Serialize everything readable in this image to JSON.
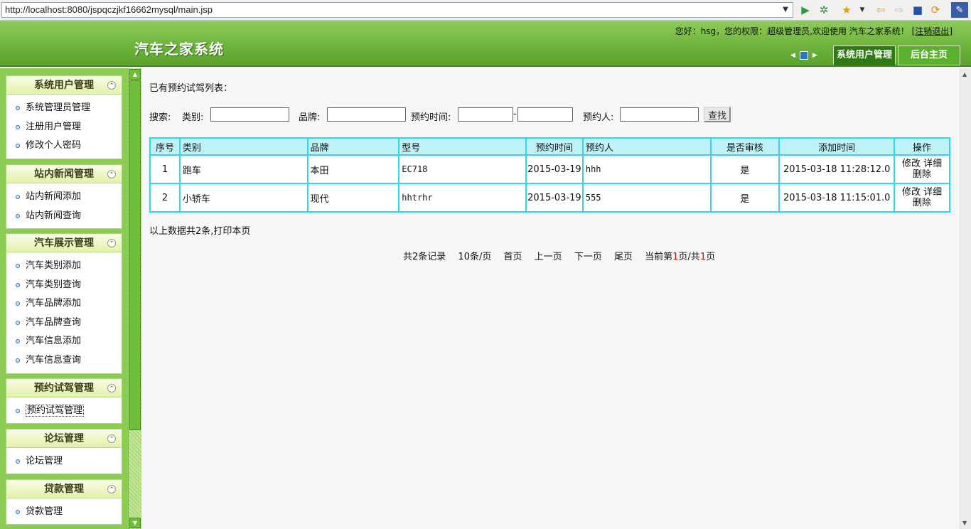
{
  "browser": {
    "url": "http://localhost:8080/jspqczjkf16662mysql/main.jsp",
    "toolbar_icons": [
      "play-icon",
      "gear-icon",
      "star-icon",
      "back-icon",
      "forward-icon",
      "stop-icon",
      "refresh-icon",
      "app-icon"
    ]
  },
  "header": {
    "site_title": "汽车之家系统",
    "welcome_prefix": "您好：hsg，您的权限：超级管理员,欢迎使用 汽车之家系统！ [",
    "logout": "注销退出",
    "welcome_suffix": "]",
    "tabs": [
      "系统用户管理",
      "后台主页"
    ]
  },
  "sidebar": {
    "panels": [
      {
        "title": "系统用户管理",
        "items": [
          "系统管理员管理",
          "注册用户管理",
          "修改个人密码"
        ]
      },
      {
        "title": "站内新闻管理",
        "items": [
          "站内新闻添加",
          "站内新闻查询"
        ]
      },
      {
        "title": "汽车展示管理",
        "items": [
          "汽车类别添加",
          "汽车类别查询",
          "汽车品牌添加",
          "汽车品牌查询",
          "汽车信息添加",
          "汽车信息查询"
        ]
      },
      {
        "title": "预约试驾管理",
        "items": [
          "预约试驾管理"
        ]
      },
      {
        "title": "论坛管理",
        "items": [
          "论坛管理"
        ]
      },
      {
        "title": "贷款管理",
        "items": [
          "贷款管理"
        ]
      }
    ]
  },
  "main": {
    "list_title": "已有预约试驾列表：",
    "search": {
      "label": "搜索:",
      "category_label": "类别:",
      "brand_label": "品牌:",
      "time_label": "预约时间:",
      "time_sep": "-",
      "person_label": "预约人:",
      "button": "查找"
    },
    "table": {
      "headers": [
        "序号",
        "类别",
        "品牌",
        "型号",
        "预约时间",
        "预约人",
        "是否审核",
        "添加时间",
        "操作"
      ],
      "rows": [
        {
          "no": "1",
          "category": "跑车",
          "brand": "本田",
          "model": "EC718",
          "time": "2015-03-19",
          "person": "hhh",
          "reviewed": "是",
          "added": "2015-03-18 11:28:12.0",
          "edit": "修改",
          "detail": "详细",
          "delete": "删除"
        },
        {
          "no": "2",
          "category": "小轿车",
          "brand": "现代",
          "model": "hhtrhr",
          "time": "2015-03-19",
          "person": "555",
          "reviewed": "是",
          "added": "2015-03-18 11:15:01.0",
          "edit": "修改",
          "detail": "详细",
          "delete": "删除"
        }
      ]
    },
    "summary_prefix": "以上数据共2条,",
    "print_link": "打印本页",
    "pager": {
      "total": "共2条记录",
      "per_page": "10条/页",
      "first": "首页",
      "prev": "上一页",
      "next": "下一页",
      "last": "尾页",
      "current_prefix": "当前第",
      "current_page": "1",
      "current_mid": "页/共",
      "total_pages": "1",
      "current_suffix": "页"
    }
  }
}
